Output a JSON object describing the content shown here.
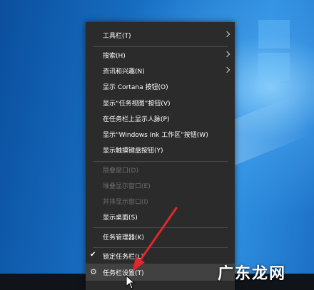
{
  "context_menu": {
    "items": [
      {
        "label": "工具栏(T)"
      },
      {
        "label": "搜索(H)"
      },
      {
        "label": "资讯和兴趣(N)"
      },
      {
        "label": "显示 Cortana 按钮(O)"
      },
      {
        "label": "显示“任务视图”按钮(V)"
      },
      {
        "label": "在任务栏上显示人脉(P)"
      },
      {
        "label": "显示“Windows Ink 工作区”按钮(W)"
      },
      {
        "label": "显示触摸键盘按钮(Y)"
      },
      {
        "label": "层叠窗口(D)"
      },
      {
        "label": "堆叠显示窗口(E)"
      },
      {
        "label": "并排显示窗口(I)"
      },
      {
        "label": "显示桌面(S)"
      },
      {
        "label": "任务管理器(K)"
      },
      {
        "label": "锁定任务栏(L)"
      },
      {
        "label": "任务栏设置(T)"
      }
    ]
  },
  "watermark": "广东龙网",
  "colors": {
    "menu_bg": "#2b2b2b",
    "annotation_arrow": "#e0272d",
    "hover_bg": "#414141"
  },
  "icons": {
    "submenu": "chevron-right-icon",
    "checked": "checkmark-icon",
    "settings": "gear-icon",
    "pointer": "mouse-cursor-icon"
  }
}
